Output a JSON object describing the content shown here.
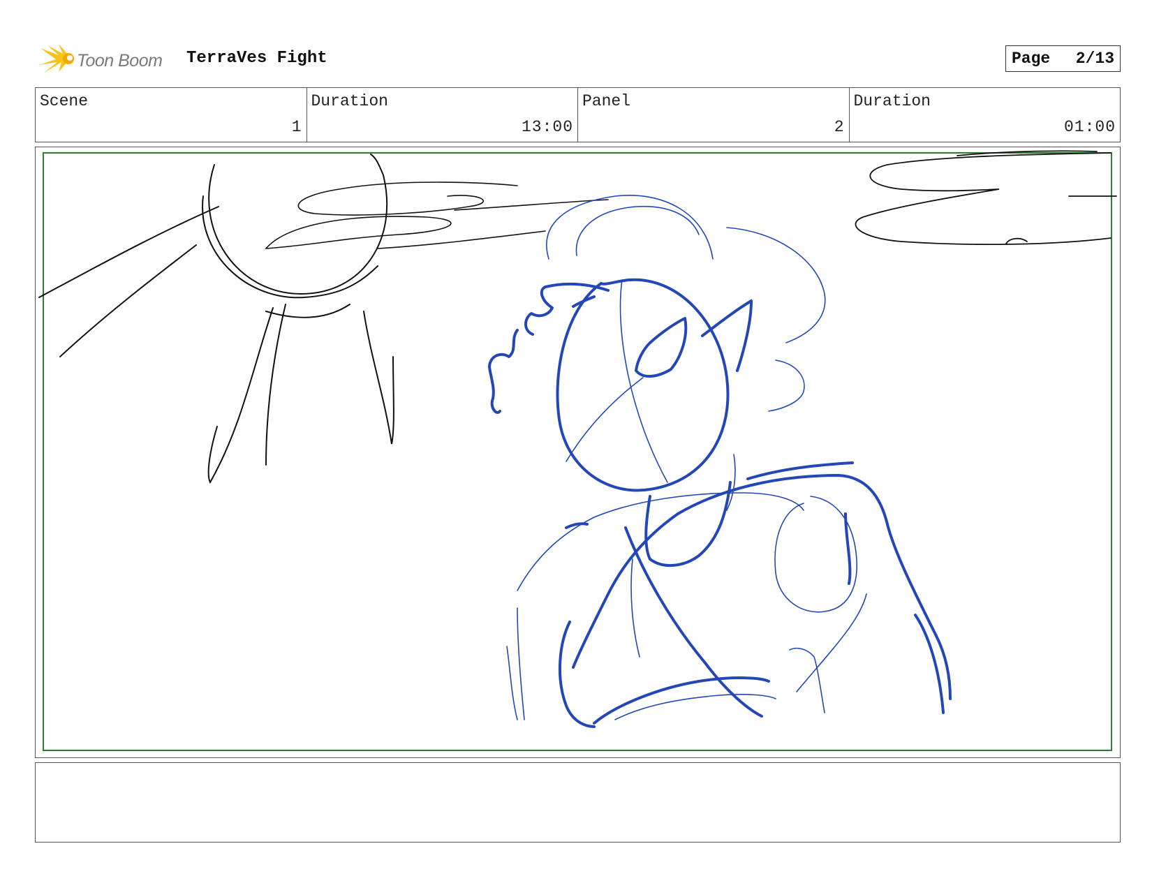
{
  "header": {
    "logo_text": "Toon Boom",
    "project_title": "TerraVes Fight",
    "page_label": "Page",
    "page_number": "2/13"
  },
  "info": {
    "scene_label": "Scene",
    "scene_value": "1",
    "scene_duration_label": "Duration",
    "scene_duration_value": "13:00",
    "panel_label": "Panel",
    "panel_value": "2",
    "panel_duration_label": "Duration",
    "panel_duration_value": "01:00"
  },
  "panel": {
    "safe_frame_color": "#2e7d32",
    "sketch_color_character": "#2447b8",
    "sketch_color_background": "#111111"
  },
  "notes": {
    "text": ""
  }
}
